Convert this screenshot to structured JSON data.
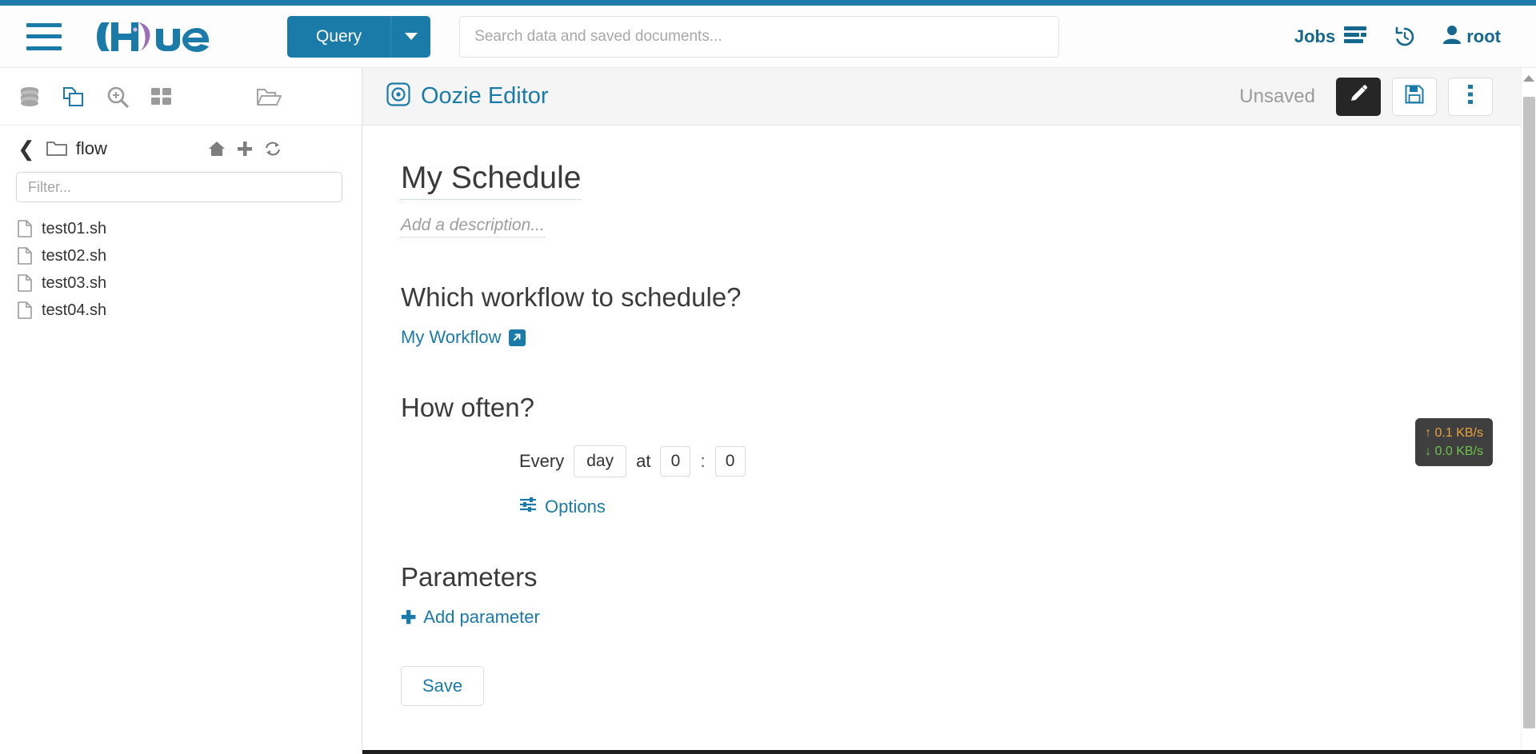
{
  "colors": {
    "accent": "#1b7ba8",
    "top_strip": "#1f7ba8",
    "logo_purple": "#9b6fb5",
    "dark_button": "#262626",
    "net_up": "#e8a33d",
    "net_down": "#6dc24b"
  },
  "header": {
    "menu_icon": "hamburger-icon",
    "logo_text": "Hue",
    "query_label": "Query",
    "query_caret_icon": "chevron-down-icon",
    "search": {
      "value": "",
      "placeholder": "Search data and saved documents..."
    },
    "jobs_label": "Jobs",
    "jobs_icon": "jobs-list-icon",
    "history_icon": "history-clock-icon",
    "user_label": "root",
    "user_icon": "user-icon"
  },
  "sidebar": {
    "tools": [
      {
        "name": "database-icon",
        "label": "Databases"
      },
      {
        "name": "documents-icon",
        "label": "Documents"
      },
      {
        "name": "search-zoom-icon",
        "label": "Search"
      },
      {
        "name": "grid-apps-icon",
        "label": "Apps"
      }
    ],
    "right_tool": {
      "name": "open-folder-icon",
      "label": "Browse files"
    },
    "breadcrumb": {
      "back_icon": "chevron-left-icon",
      "folder_icon": "folder-icon",
      "name": "flow",
      "actions": [
        {
          "name": "home-icon",
          "label": "Home"
        },
        {
          "name": "plus-icon",
          "label": "New"
        },
        {
          "name": "refresh-icon",
          "label": "Refresh"
        }
      ]
    },
    "filter": {
      "value": "",
      "placeholder": "Filter..."
    },
    "files": [
      {
        "name": "test01.sh",
        "icon": "file-icon"
      },
      {
        "name": "test02.sh",
        "icon": "file-icon"
      },
      {
        "name": "test03.sh",
        "icon": "file-icon"
      },
      {
        "name": "test04.sh",
        "icon": "file-icon"
      }
    ]
  },
  "editor_bar": {
    "app_icon": "oozie-target-icon",
    "title": "Oozie Editor",
    "status": "Unsaved",
    "edit_icon": "pencil-icon",
    "save_icon": "floppy-save-icon",
    "more_icon": "kebab-menu-icon"
  },
  "document": {
    "title": "My Schedule",
    "description_placeholder": "Add a description..."
  },
  "sections": {
    "workflow": {
      "heading": "Which workflow to schedule?",
      "link_label": "My Workflow",
      "external_icon": "external-link-icon"
    },
    "frequency": {
      "heading": "How often?",
      "every_label": "Every",
      "unit_value": "day",
      "at_label": "at",
      "hour_value": "0",
      "minute_value": "0",
      "time_separator": ":",
      "options_label": "Options",
      "options_icon": "sliders-icon"
    },
    "parameters": {
      "heading": "Parameters",
      "add_label": "Add parameter",
      "add_icon": "plus-icon"
    },
    "save_label": "Save"
  },
  "net_widget": {
    "up_value": "0.1 KB/s",
    "down_value": "0.0 KB/s",
    "up_icon": "arrow-up-icon",
    "down_icon": "arrow-down-icon"
  }
}
